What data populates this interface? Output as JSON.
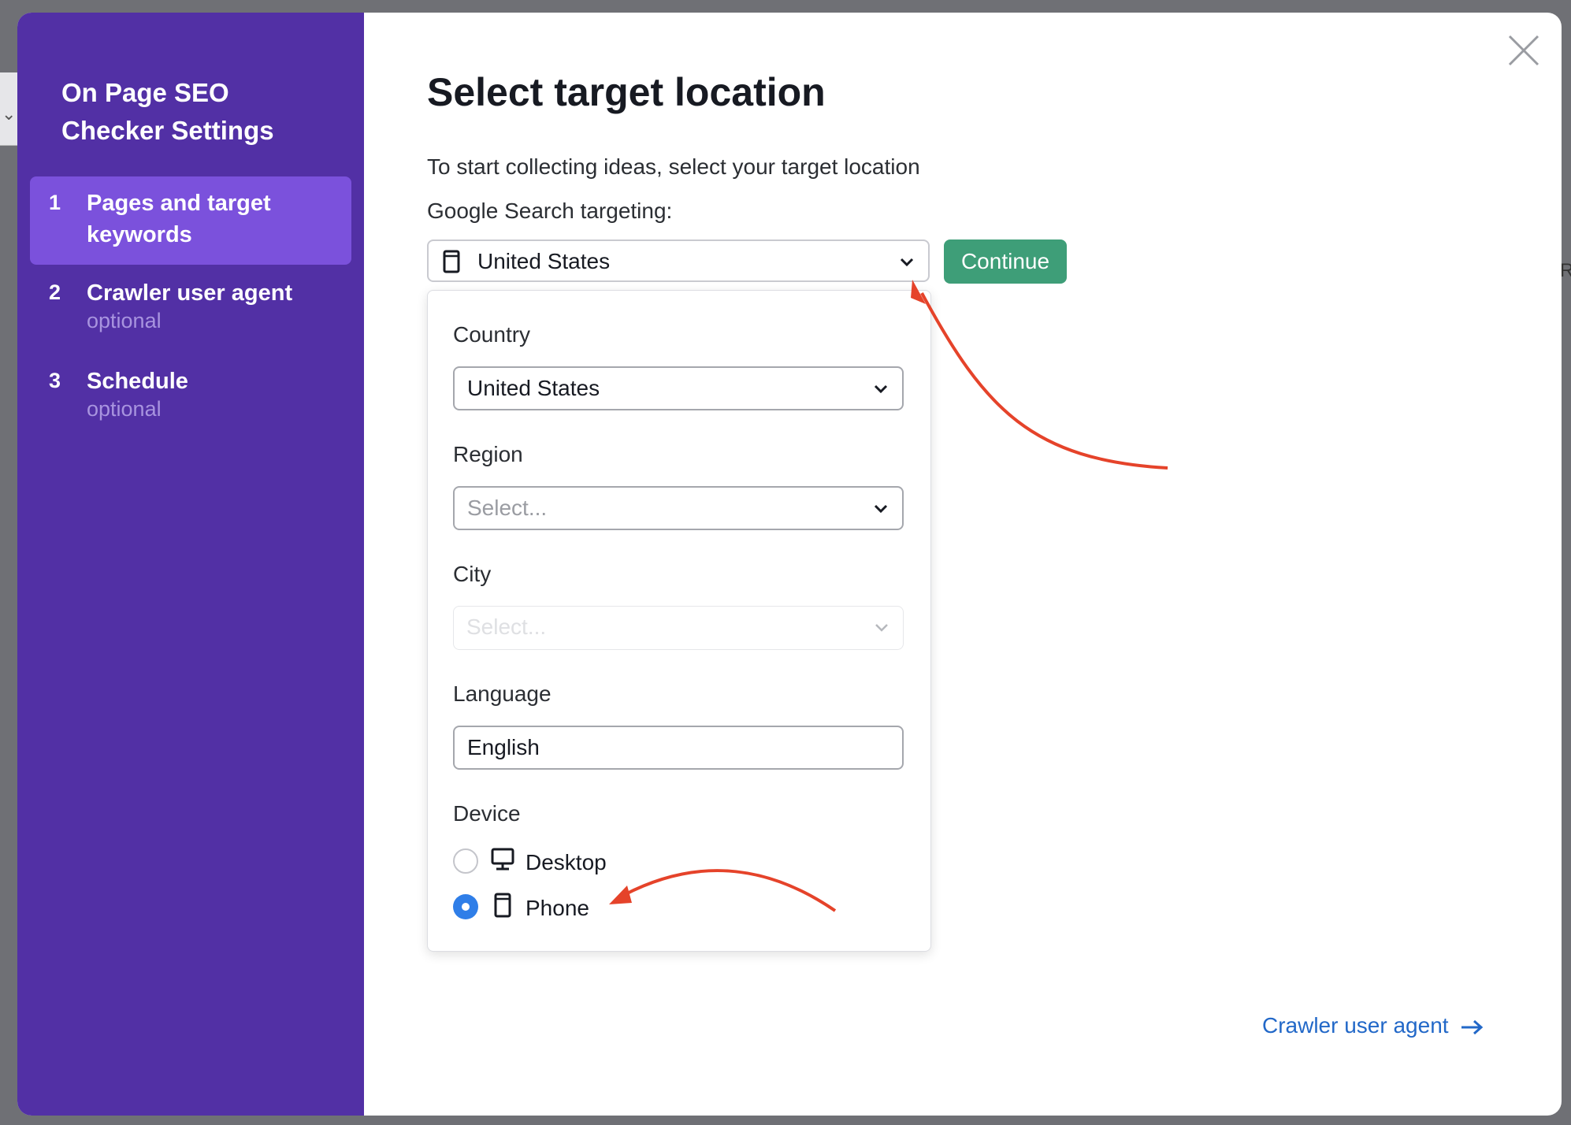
{
  "sidebar": {
    "title": "On Page SEO Checker Settings",
    "steps": [
      {
        "num": "1",
        "label": "Pages and target keywords",
        "sub": ""
      },
      {
        "num": "2",
        "label": "Crawler user agent",
        "sub": "optional"
      },
      {
        "num": "3",
        "label": "Schedule",
        "sub": "optional"
      }
    ]
  },
  "main": {
    "title": "Select target location",
    "subtitle": "To start collecting ideas, select your target location",
    "targeting_label": "Google Search targeting:",
    "targeting_value": "United States",
    "continue_label": "Continue",
    "next_link": "Crawler user agent"
  },
  "dropdown": {
    "country_label": "Country",
    "country_value": "United States",
    "region_label": "Region",
    "region_placeholder": "Select...",
    "city_label": "City",
    "city_placeholder": "Select...",
    "language_label": "Language",
    "language_value": "English",
    "device_label": "Device",
    "devices": [
      {
        "label": "Desktop",
        "icon": "desktop-icon",
        "checked": false
      },
      {
        "label": "Phone",
        "icon": "phone-icon",
        "checked": true
      }
    ]
  },
  "colors": {
    "sidebar_bg": "#5230a5",
    "active_step": "#7b51dc",
    "continue_btn": "#3e9e78",
    "link": "#2268c8",
    "radio_checked": "#2f7ee8",
    "annotation_arrow": "#e5432a"
  }
}
